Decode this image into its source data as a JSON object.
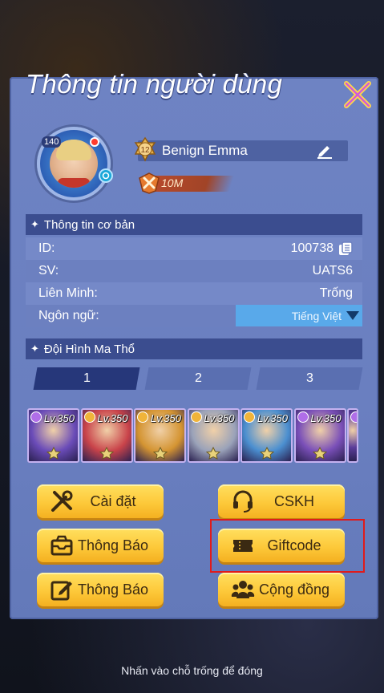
{
  "window": {
    "title": "Thông tin người dùng"
  },
  "profile": {
    "level": "140",
    "name": "Benign Emma",
    "vip_level": "12",
    "power": "10M"
  },
  "basic_info": {
    "header": "Thông tin cơ bản",
    "rows": [
      {
        "label": "ID:",
        "value": "100738"
      },
      {
        "label": "SV:",
        "value": "UATS6"
      },
      {
        "label": "Liên Minh:",
        "value": "Trống"
      },
      {
        "label": "Ngôn ngữ:",
        "value": "Tiếng Việt"
      }
    ]
  },
  "formation": {
    "header": "Đội Hình Ma Thổ",
    "tabs": [
      {
        "label": "1",
        "active": true
      },
      {
        "label": "2",
        "active": false
      },
      {
        "label": "3",
        "active": false
      }
    ],
    "heroes": [
      {
        "level": "Lv.350",
        "gem_color": "#b06ee8",
        "theme": "#6a4bb8"
      },
      {
        "level": "Lv.350",
        "gem_color": "#f0b43a",
        "theme": "#c9434a"
      },
      {
        "level": "Lv.350",
        "gem_color": "#f0b43a",
        "theme": "#d49432"
      },
      {
        "level": "Lv.350",
        "gem_color": "#f0b43a",
        "theme": "#9aa2b9"
      },
      {
        "level": "Lv.350",
        "gem_color": "#f0b43a",
        "theme": "#4b8fd0"
      },
      {
        "level": "Lv.350",
        "gem_color": "#b06ee8",
        "theme": "#7a4fb8"
      },
      {
        "level": "",
        "gem_color": "#b06ee8",
        "theme": "#5a3c9a"
      }
    ]
  },
  "buttons": {
    "settings": {
      "label": "Cài đặt",
      "icon": "tools-icon"
    },
    "support": {
      "label": "CSKH",
      "icon": "headset-icon"
    },
    "notice": {
      "label": "Thông Báo",
      "icon": "inbox-icon"
    },
    "giftcode": {
      "label": "Giftcode",
      "icon": "ticket-icon"
    },
    "feedback": {
      "label": "Thông Báo",
      "icon": "edit-note-icon"
    },
    "community": {
      "label": "Cộng đồng",
      "icon": "community-icon"
    }
  },
  "footer": {
    "hint": "Nhấn vào chỗ trống để đóng"
  },
  "colors": {
    "panel": "#6e83c3",
    "section_header": "#3b4d8f",
    "button_yellow": "#fdc93a",
    "highlight": "#e01b1b",
    "language_select": "#59a9ea"
  }
}
